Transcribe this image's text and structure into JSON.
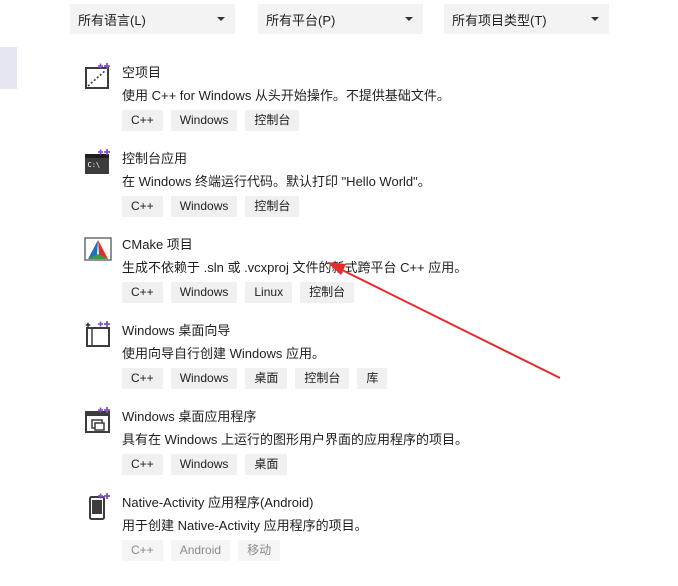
{
  "filters": [
    {
      "value": "所有语言(L)"
    },
    {
      "value": "所有平台(P)"
    },
    {
      "value": "所有项目类型(T)"
    }
  ],
  "templates": [
    {
      "title": "空项目",
      "description": "使用 C++ for Windows 从头开始操作。不提供基础文件。",
      "tags": [
        "C++",
        "Windows",
        "控制台"
      ],
      "icon": "empty-project-icon"
    },
    {
      "title": "控制台应用",
      "description": "在 Windows 终端运行代码。默认打印 \"Hello World\"。",
      "tags": [
        "C++",
        "Windows",
        "控制台"
      ],
      "icon": "console-app-icon"
    },
    {
      "title": "CMake 项目",
      "description": "生成不依赖于 .sln 或 .vcxproj 文件的新式跨平台 C++ 应用。",
      "tags": [
        "C++",
        "Windows",
        "Linux",
        "控制台"
      ],
      "icon": "cmake-icon"
    },
    {
      "title": "Windows 桌面向导",
      "description": "使用向导自行创建 Windows 应用。",
      "tags": [
        "C++",
        "Windows",
        "桌面",
        "控制台",
        "库"
      ],
      "icon": "desktop-wizard-icon"
    },
    {
      "title": "Windows 桌面应用程序",
      "description": "具有在 Windows 上运行的图形用户界面的应用程序的项目。",
      "tags": [
        "C++",
        "Windows",
        "桌面"
      ],
      "icon": "desktop-app-icon"
    },
    {
      "title": "Native-Activity 应用程序(Android)",
      "description": "用于创建 Native-Activity 应用程序的项目。",
      "tags": [
        "C++",
        "Android",
        "移动"
      ],
      "icon": "android-phone-icon"
    }
  ],
  "colors": {
    "accent_purple": "#7e4fc7",
    "annotation_red": "#e52b2b",
    "icon_dark": "#3c3c3c"
  }
}
